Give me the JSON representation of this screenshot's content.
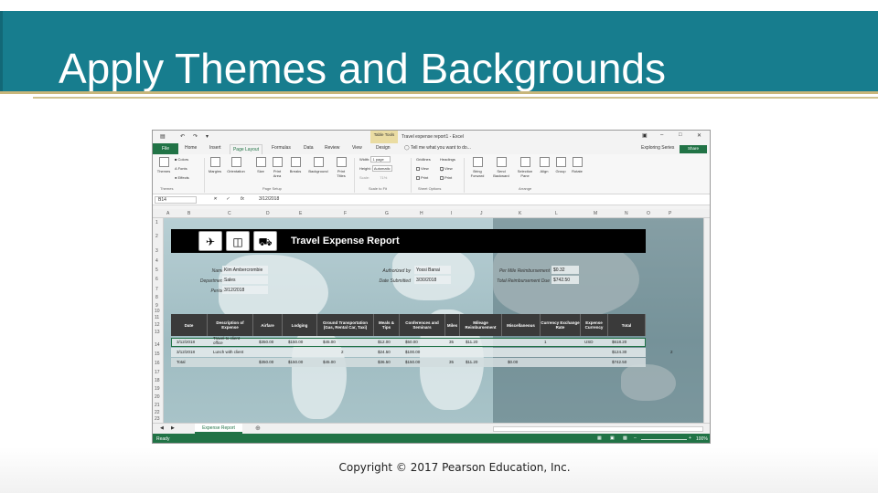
{
  "slide": {
    "title": "Apply Themes and Backgrounds",
    "copyright": "Copyright © 2017 Pearson Education, Inc.",
    "colors": {
      "title_bar": "#177d8e",
      "accent_line": "#c8b67a",
      "excel_green": "#217346"
    }
  },
  "excel": {
    "context_tab": "Table Tools",
    "window_title": "Travel expense report1 - Excel",
    "tabs": [
      "File",
      "Home",
      "Insert",
      "Page Layout",
      "Formulas",
      "Data",
      "Review",
      "View",
      "Design"
    ],
    "active_tab": "Page Layout",
    "tell_me": "Tell me what you want to do...",
    "user": "Exploring Series",
    "share": "Share",
    "ribbon": {
      "themes_buttons": {
        "themes": "Themes",
        "colors": "Colors",
        "fonts": "Fonts",
        "effects": "Effects"
      },
      "page_setup_buttons": [
        "Margins",
        "Orientation",
        "Size",
        "Print Area",
        "Breaks",
        "Background",
        "Print Titles"
      ],
      "scale": {
        "width_label": "Width:",
        "width_value": "1 page",
        "height_label": "Height:",
        "height_value": "Automatic",
        "scale_label": "Scale:",
        "scale_value": "71%"
      },
      "sheet_options": {
        "gridlines": "Gridlines",
        "headings": "Headings",
        "view": "View",
        "print": "Print"
      },
      "arrange_buttons": [
        "Bring Forward",
        "Send Backward",
        "Selection Pane",
        "Align",
        "Group",
        "Rotate"
      ],
      "groups": {
        "themes": "Themes",
        "page_setup": "Page Setup",
        "scale_to_fit": "Scale to Fit",
        "sheet_options": "Sheet Options",
        "arrange": "Arrange"
      }
    },
    "name_box": "B14",
    "formula_value": "3/12/2018",
    "columns": [
      "A",
      "B",
      "C",
      "D",
      "E",
      "F",
      "G",
      "H",
      "I",
      "J",
      "K",
      "L",
      "M",
      "N",
      "O",
      "P"
    ],
    "rows": [
      "1",
      "2",
      "3",
      "4",
      "5",
      "6",
      "7",
      "8",
      "9",
      "10",
      "11",
      "12",
      "13",
      "14",
      "15",
      "16",
      "17",
      "18",
      "19",
      "20",
      "21",
      "22",
      "23"
    ],
    "report": {
      "title": "Travel Expense Report",
      "icons": [
        "airplane-icon",
        "train-icon",
        "car-icon"
      ],
      "fields": {
        "name_label": "Name",
        "name_value": "Kim Ambercrombie",
        "department_label": "Department",
        "department_value": "Sales",
        "period_label": "Period",
        "period_value": "3/12/2018",
        "authorized_label": "Authorized by",
        "authorized_value": "Yossi Banai",
        "date_submitted_label": "Date Submitted",
        "date_submitted_value": "3/30/2018",
        "per_mile_label": "Per Mile Reimbursement",
        "per_mile_value": "$0.32",
        "total_due_label": "Total Reimbursement Due",
        "total_due_value": "$742.50"
      },
      "headers": [
        "Date",
        "Description of Expense",
        "Airfare",
        "Lodging",
        "Ground Transportation (Gas, Rental Car, Taxi)",
        "Meals & Tips",
        "Conferences and Seminars",
        "Miles",
        "Mileage Reimbursement",
        "Miscellaneous",
        "Currency Exchange Rate",
        "Expense Currency",
        "Total"
      ],
      "rows": [
        [
          "3/12/2018",
          "Travel to client office",
          "$350.00",
          "$150.00",
          "$45.00",
          "$12.00",
          "$50.00",
          "35",
          "$11.20",
          "",
          "1",
          "USD",
          "$618.20"
        ],
        [
          "3/12/2018",
          "Lunch with client",
          "",
          "",
          "",
          "$24.50",
          "$100.00",
          "",
          "",
          "",
          "",
          "",
          "$124.30"
        ],
        [
          "Total",
          "",
          "$350.00",
          "$150.00",
          "$45.00",
          "$36.50",
          "$150.00",
          "35",
          "$11.20",
          "$0.00",
          "",
          "",
          "$742.50"
        ]
      ],
      "stray_values": {
        "row15_g": "2",
        "row15_o": "2"
      }
    },
    "sheet_tab": "Expense Report",
    "status": {
      "ready": "Ready",
      "zoom": "100%"
    }
  }
}
